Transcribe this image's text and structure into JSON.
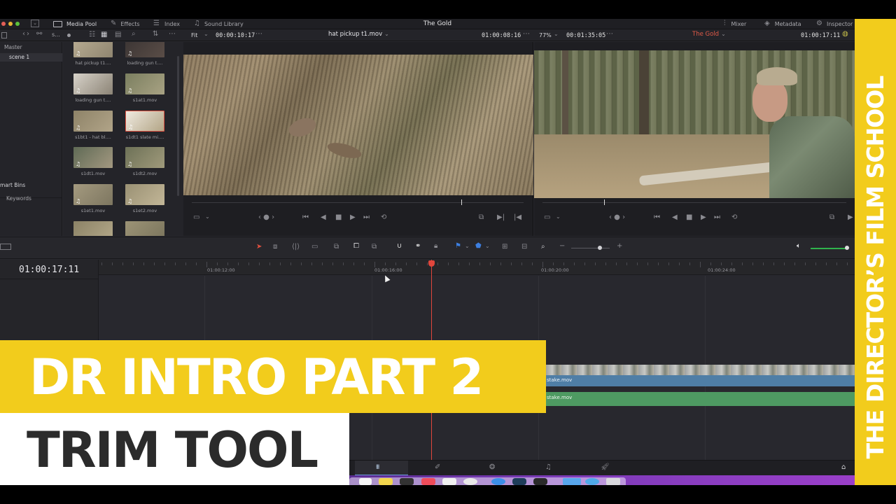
{
  "toolbar": {
    "media_pool": "Media Pool",
    "effects": "Effects",
    "index": "Index",
    "sound_library": "Sound Library",
    "project_title": "The Gold",
    "mixer": "Mixer",
    "metadata": "Metadata",
    "inspector": "Inspector"
  },
  "source_viewer": {
    "zoom": "Fit",
    "timecode_left": "00:00:10:17",
    "clip_name": "hat pickup t1.mov",
    "timecode_right": "01:00:08:16"
  },
  "timeline_viewer": {
    "zoom": "77%",
    "timecode_left": "00:01:35:05",
    "timeline_name": "The Gold",
    "timecode_right": "01:00:17:11"
  },
  "bins": {
    "master": "Master",
    "scene": "scene 1",
    "smart_bins": "mart Bins",
    "keywords": "Keywords",
    "search_short": "s..."
  },
  "clips": [
    {
      "name": "hat pickup t1...."
    },
    {
      "name": "loading gun t...."
    },
    {
      "name": "loading gun t...."
    },
    {
      "name": "s1at1.mov"
    },
    {
      "name": "s1bt1 - hat bl...."
    },
    {
      "name": "s1dt1 slate mi...."
    },
    {
      "name": "s1dt1.mov"
    },
    {
      "name": "s1dt2.mov"
    },
    {
      "name": "s1et1.mov"
    },
    {
      "name": "s1et2.mov"
    }
  ],
  "timeline": {
    "current_timecode": "01:00:17:11",
    "ruler": [
      "01:00:12:00",
      "01:00:16:00",
      "01:00:20:00",
      "01:00:24:00"
    ],
    "video_clip": "stake.mov",
    "audio_clip": "stake.mov",
    "playhead_fraction": 0.4
  },
  "overlay": {
    "title_line1": "DR INTRO PART 2",
    "title_line2": "TRIM TOOL",
    "side_banner": "THE DIRECTOR’S FILM SCHOOL"
  },
  "colors": {
    "accent_yellow": "#f2cc1c",
    "video_clip": "#4f7ea6",
    "audio_clip": "#4e9a62",
    "playhead": "#e0463c",
    "timeline_name": "#e05a48"
  }
}
